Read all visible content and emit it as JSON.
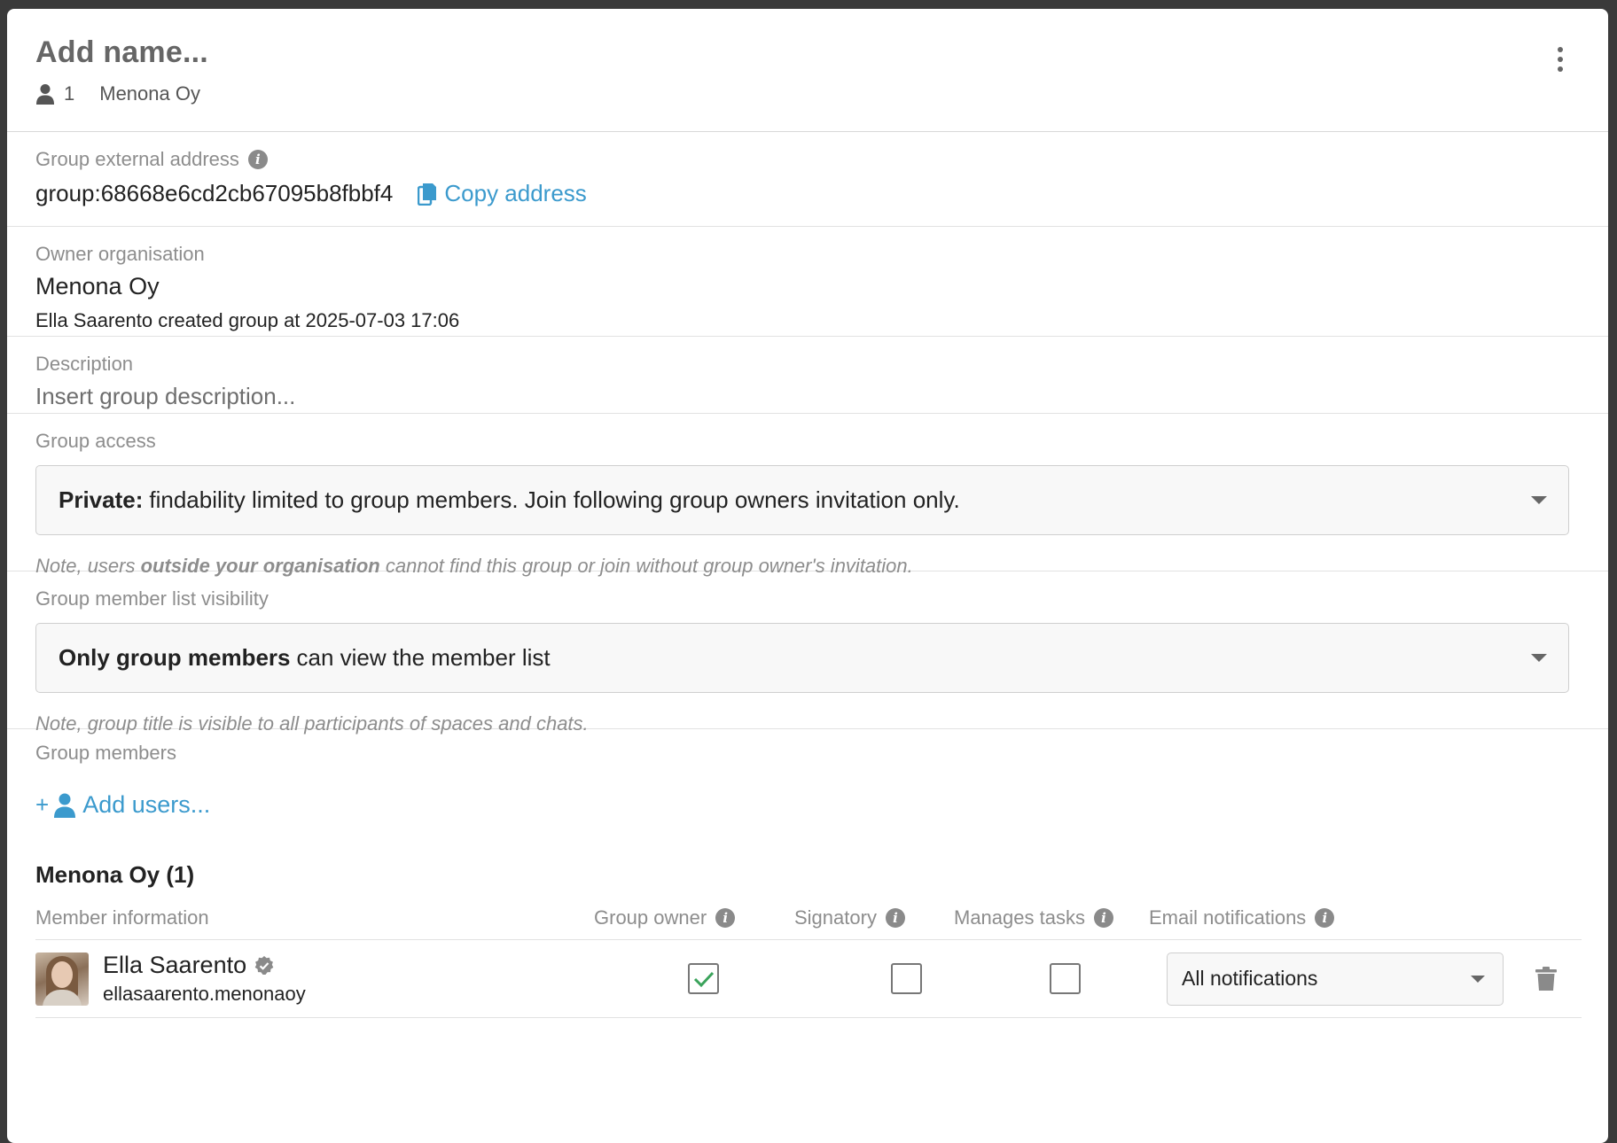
{
  "header": {
    "title": "Add name...",
    "member_count": "1",
    "org": "Menona Oy"
  },
  "external_address": {
    "label": "Group external address",
    "value": "group:68668e6cd2cb67095b8fbbf4",
    "copy_label": "Copy address"
  },
  "owner": {
    "label": "Owner organisation",
    "org": "Menona Oy",
    "created": "Ella Saarento created group at 2025-07-03 17:06"
  },
  "description": {
    "label": "Description",
    "placeholder": "Insert group description..."
  },
  "access": {
    "label": "Group access",
    "selected_bold": "Private:",
    "selected_rest": "findability limited to group members. Join following group owners invitation only.",
    "note_pre": "Note, users ",
    "note_bold": "outside your organisation",
    "note_post": " cannot find this group or join without group owner's invitation."
  },
  "visibility": {
    "label": "Group member list visibility",
    "selected_bold": "Only group members",
    "selected_rest": "can view the member list",
    "note": "Note, group title is visible to all participants of spaces and chats."
  },
  "members": {
    "label": "Group members",
    "add_plus": "+",
    "add_label": "Add users...",
    "org_heading": "Menona Oy (1)",
    "columns": {
      "info": "Member information",
      "owner": "Group owner",
      "signatory": "Signatory",
      "tasks": "Manages tasks",
      "email": "Email notifications"
    },
    "rows": [
      {
        "name": "Ella Saarento",
        "username": "ellasaarento.menonaoy",
        "group_owner": true,
        "signatory": false,
        "manages_tasks": false,
        "email_notifications": "All notifications"
      }
    ]
  },
  "colors": {
    "accent": "#3b9acd",
    "check": "#3aa35b",
    "muted": "#8d8d8d"
  },
  "icons": [
    "person-icon",
    "kebab-menu-icon",
    "info-icon",
    "copy-icon",
    "add-user-icon",
    "verified-icon",
    "checkmark-icon",
    "chevron-down-icon",
    "trash-icon"
  ]
}
